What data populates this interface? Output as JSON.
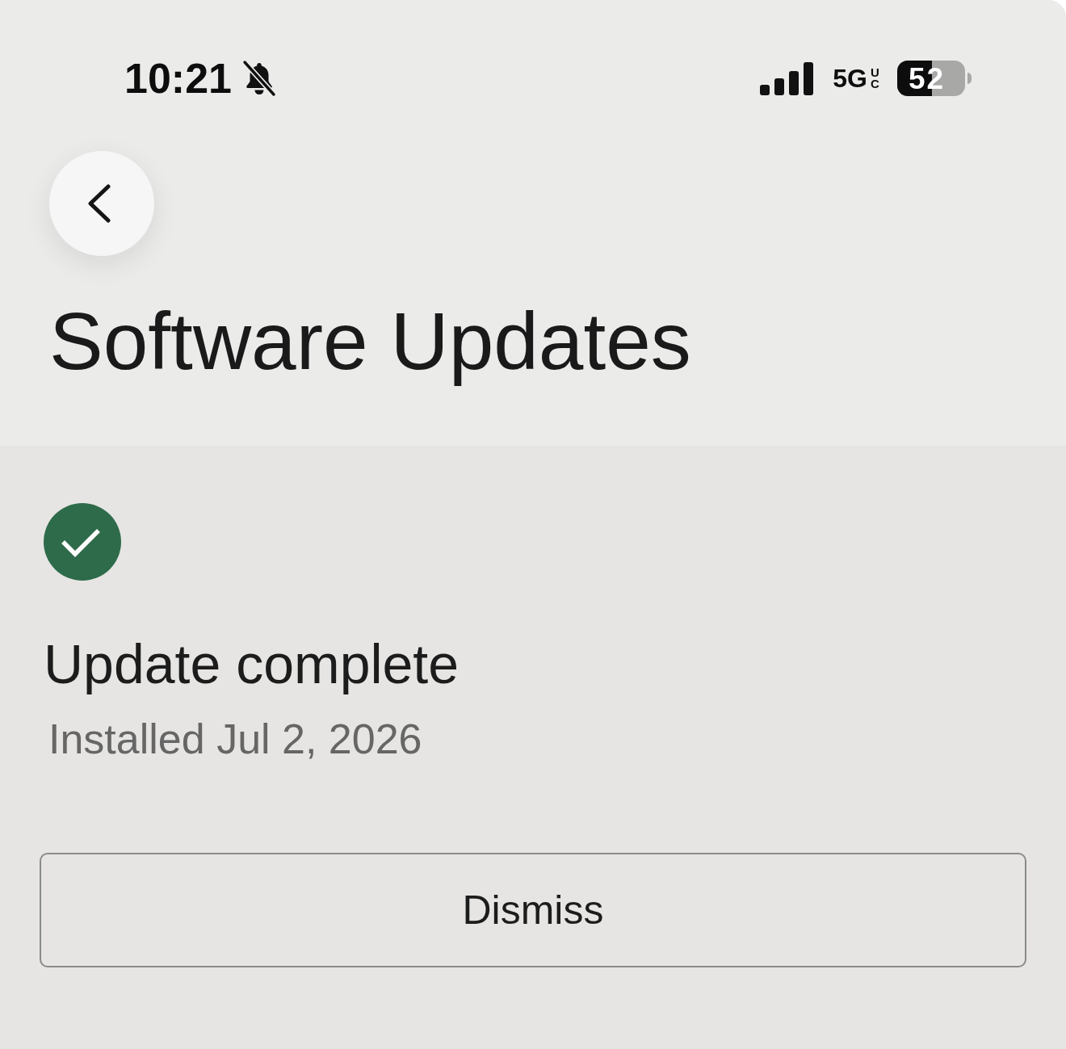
{
  "status_bar": {
    "time": "10:21",
    "silent_mode": true,
    "network": "5G",
    "network_badge": "UC",
    "battery": "52"
  },
  "header": {
    "title": "Software Updates"
  },
  "status": {
    "kind": "complete",
    "title": "Update complete",
    "subtitle": "Installed Jul 2, 2026"
  },
  "buttons": [
    {
      "label": "Dismiss"
    }
  ]
}
